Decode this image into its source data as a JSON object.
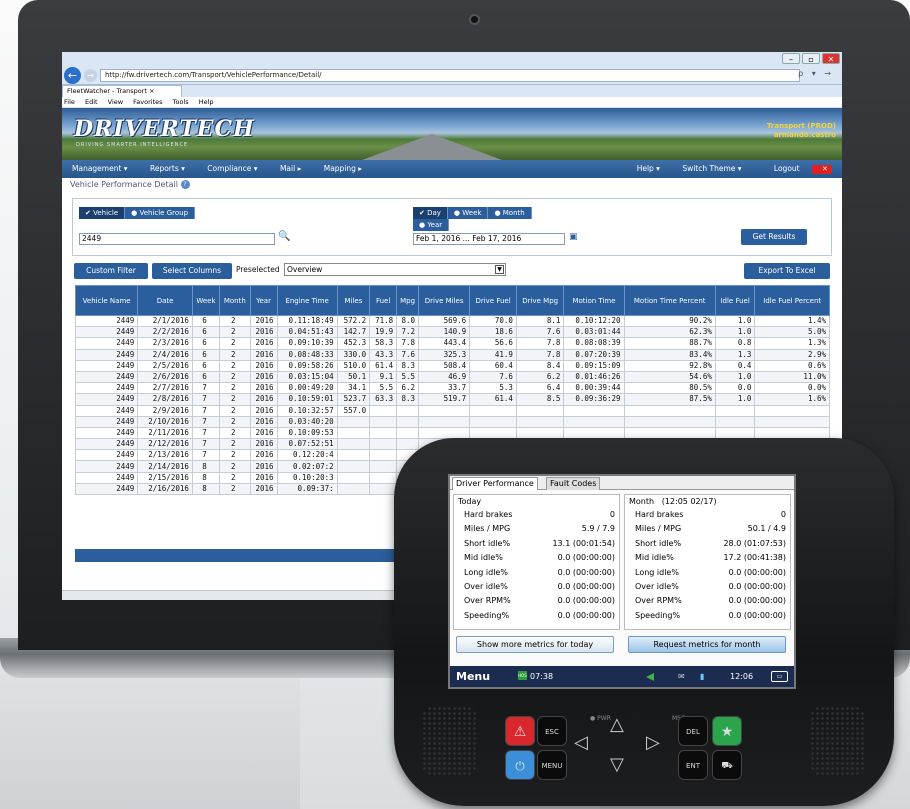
{
  "browser": {
    "url": "http://fw.drivertech.com/Transport/VehiclePerformance/Detail/",
    "url_tail": "ρ ▾ →",
    "tab_title": "FleetWatcher - Transport",
    "menu": [
      "File",
      "Edit",
      "View",
      "Favorites",
      "Tools",
      "Help"
    ]
  },
  "app": {
    "logo": "DRIVERTECH",
    "tagline": "DRIVING SMARTER INTELLIGENCE",
    "tenant": "Transport (PROD)",
    "user": "armando.castro",
    "nav_left": [
      "Management ▾",
      "Reports ▾",
      "Compliance ▾",
      "Mail ▸",
      "Mapping ▸"
    ],
    "nav_right": [
      "Help ▾",
      "Switch Theme ▾",
      "Logout"
    ],
    "page_title": "Vehicle Performance Detail"
  },
  "criteria": {
    "vehicle_tabs": [
      "✔ Vehicle",
      "● Vehicle Group"
    ],
    "vehicle_value": "2449",
    "period_tabs": [
      "✔ Day",
      "● Week",
      "● Month"
    ],
    "period_tab_year": "● Year",
    "date_range": "Feb 1, 2016 ... Feb 17, 2016",
    "get_results": "Get Results"
  },
  "toolbar": {
    "custom_filter": "Custom Filter",
    "select_columns": "Select Columns",
    "preselected_label": "Preselected",
    "preselected_value": "Overview",
    "export": "Export To Excel"
  },
  "table": {
    "headers": [
      "Vehicle Name",
      "Date",
      "Week",
      "Month",
      "Year",
      "Engine Time",
      "Miles",
      "Fuel",
      "Mpg",
      "Drive Miles",
      "Drive Fuel",
      "Drive Mpg",
      "Motion Time",
      "Motion Time Percent",
      "Idle Fuel",
      "Idle Fuel Percent"
    ],
    "rows": [
      [
        "2449",
        "2/1/2016",
        "6",
        "2",
        "2016",
        "0.11:18:49",
        "572.2",
        "71.8",
        "8.0",
        "569.6",
        "70.0",
        "8.1",
        "0.10:12:20",
        "90.2%",
        "1.0",
        "1.4%"
      ],
      [
        "2449",
        "2/2/2016",
        "6",
        "2",
        "2016",
        "0.04:51:43",
        "142.7",
        "19.9",
        "7.2",
        "140.9",
        "18.6",
        "7.6",
        "0.03:01:44",
        "62.3%",
        "1.0",
        "5.0%"
      ],
      [
        "2449",
        "2/3/2016",
        "6",
        "2",
        "2016",
        "0.09:10:39",
        "452.3",
        "58.3",
        "7.8",
        "443.4",
        "56.6",
        "7.8",
        "0.08:08:39",
        "88.7%",
        "0.8",
        "1.3%"
      ],
      [
        "2449",
        "2/4/2016",
        "6",
        "2",
        "2016",
        "0.08:48:33",
        "330.0",
        "43.3",
        "7.6",
        "325.3",
        "41.9",
        "7.8",
        "0.07:20:39",
        "83.4%",
        "1.3",
        "2.9%"
      ],
      [
        "2449",
        "2/5/2016",
        "6",
        "2",
        "2016",
        "0.09:58:26",
        "510.0",
        "61.4",
        "8.3",
        "508.4",
        "60.4",
        "8.4",
        "0.09:15:09",
        "92.8%",
        "0.4",
        "0.6%"
      ],
      [
        "2449",
        "2/6/2016",
        "6",
        "2",
        "2016",
        "0.03:15:04",
        "50.1",
        "9.1",
        "5.5",
        "46.9",
        "7.6",
        "6.2",
        "0.01:46:26",
        "54.6%",
        "1.0",
        "11.0%"
      ],
      [
        "2449",
        "2/7/2016",
        "7",
        "2",
        "2016",
        "0.00:49:20",
        "34.1",
        "5.5",
        "6.2",
        "33.7",
        "5.3",
        "6.4",
        "0.00:39:44",
        "80.5%",
        "0.0",
        "0.0%"
      ],
      [
        "2449",
        "2/8/2016",
        "7",
        "2",
        "2016",
        "0.10:59:01",
        "523.7",
        "63.3",
        "8.3",
        "519.7",
        "61.4",
        "8.5",
        "0.09:36:29",
        "87.5%",
        "1.0",
        "1.6%"
      ],
      [
        "2449",
        "2/9/2016",
        "7",
        "2",
        "2016",
        "0.10:32:57",
        "557.0",
        "",
        "",
        "",
        "",
        "",
        "",
        "",
        "",
        ""
      ],
      [
        "2449",
        "2/10/2016",
        "7",
        "2",
        "2016",
        "0.03:40:20",
        "",
        "",
        "",
        "",
        "",
        "",
        "",
        "",
        "",
        ""
      ],
      [
        "2449",
        "2/11/2016",
        "7",
        "2",
        "2016",
        "0.10:09:53",
        "",
        "",
        "",
        "",
        "",
        "",
        "",
        "",
        "",
        ""
      ],
      [
        "2449",
        "2/12/2016",
        "7",
        "2",
        "2016",
        "0.07:52:51",
        "",
        "",
        "",
        "",
        "",
        "",
        "",
        "",
        "",
        ""
      ],
      [
        "2449",
        "2/13/2016",
        "7",
        "2",
        "2016",
        "0.12:20:4",
        "",
        "",
        "",
        "",
        "",
        "",
        "",
        "",
        "",
        ""
      ],
      [
        "2449",
        "2/14/2016",
        "8",
        "2",
        "2016",
        "0.02:07:2",
        "",
        "",
        "",
        "",
        "",
        "",
        "",
        "",
        "",
        ""
      ],
      [
        "2449",
        "2/15/2016",
        "8",
        "2",
        "2016",
        "0.10:20:3",
        "",
        "",
        "",
        "",
        "",
        "",
        "",
        "",
        "",
        ""
      ],
      [
        "2449",
        "2/16/2016",
        "8",
        "2",
        "2016",
        "0.09:37:",
        "",
        "",
        "",
        "",
        "",
        "",
        "",
        "",
        "",
        ""
      ]
    ]
  },
  "device": {
    "tabs": [
      "Driver Performance",
      "Fault Codes"
    ],
    "today": {
      "title": "Today",
      "rows": [
        [
          "Hard brakes",
          "0"
        ],
        [
          "Miles / MPG",
          "5.9 / 7.9"
        ],
        [
          "Short idle%",
          "13.1 (00:01:54)"
        ],
        [
          "Mid idle%",
          "0.0 (00:00:00)"
        ],
        [
          "Long idle%",
          "0.0 (00:00:00)"
        ],
        [
          "Over idle%",
          "0.0 (00:00:00)"
        ],
        [
          "Over RPM%",
          "0.0 (00:00:00)"
        ],
        [
          "Speeding%",
          "0.0 (00:00:00)"
        ]
      ],
      "button": "Show more metrics for today"
    },
    "month": {
      "title": "Month",
      "range": "(12:05  02/17)",
      "rows": [
        [
          "Hard brakes",
          "0"
        ],
        [
          "Miles / MPG",
          "50.1 / 4.9"
        ],
        [
          "Short idle%",
          "28.0 (01:07:53)"
        ],
        [
          "Mid idle%",
          "17.2 (00:41:38)"
        ],
        [
          "Long idle%",
          "0.0 (00:00:00)"
        ],
        [
          "Over idle%",
          "0.0 (00:00:00)"
        ],
        [
          "Over RPM%",
          "0.0 (00:00:00)"
        ],
        [
          "Speeding%",
          "0.0 (00:00:00)"
        ]
      ],
      "button": "Request metrics for month"
    },
    "status": {
      "menu": "Menu",
      "hos": "HOS",
      "time_left": "07:38",
      "time_right": "12:06"
    },
    "keys": {
      "esc": "ESC",
      "menu": "MENU",
      "del": "DEL",
      "ent": "ENT",
      "pwr": "PWR",
      "msg": "MSG"
    }
  }
}
